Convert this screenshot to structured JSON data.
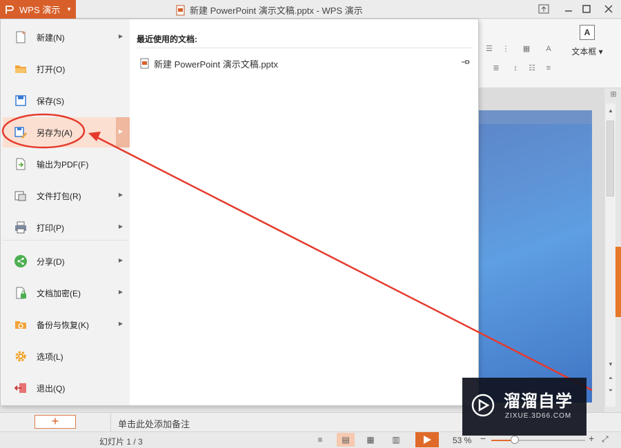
{
  "window": {
    "app_name": "WPS 演示",
    "title": "新建 PowerPoint 演示文稿.pptx - WPS 演示"
  },
  "colors": {
    "accent": "#d85f2a",
    "hover": "#fbdfd1",
    "annotation": "#e53a2d"
  },
  "file_menu": {
    "items": [
      {
        "label": "新建(N)",
        "icon": "new-document-icon",
        "submenu": true
      },
      {
        "label": "打开(O)",
        "icon": "open-folder-icon",
        "submenu": false
      },
      {
        "label": "保存(S)",
        "icon": "save-icon",
        "submenu": false
      },
      {
        "label": "另存为(A)",
        "icon": "save-as-icon",
        "submenu": true,
        "highlighted": true
      },
      {
        "label": "输出为PDF(F)",
        "icon": "pdf-export-icon",
        "submenu": false
      },
      {
        "label": "文件打包(R)",
        "icon": "package-icon",
        "submenu": true
      },
      {
        "label": "打印(P)",
        "icon": "printer-icon",
        "submenu": true
      },
      {
        "label": "分享(D)",
        "icon": "share-icon",
        "submenu": true
      },
      {
        "label": "文档加密(E)",
        "icon": "encrypt-icon",
        "submenu": true
      },
      {
        "label": "备份与恢复(K)",
        "icon": "backup-icon",
        "submenu": true
      },
      {
        "label": "选项(L)",
        "icon": "gear-icon",
        "submenu": false
      },
      {
        "label": "退出(Q)",
        "icon": "exit-icon",
        "submenu": false
      }
    ],
    "recent": {
      "title": "最近使用的文档:",
      "files": [
        "新建 PowerPoint 演示文稿.pptx"
      ]
    }
  },
  "ribbon": {
    "textbox_label": "文本框",
    "textbox_icon_letter": "A"
  },
  "notes": {
    "placeholder": "单击此处添加备注",
    "add_label": "+"
  },
  "status": {
    "slide_count": "幻灯片 1 / 3",
    "zoom": "53 %",
    "zoom_value": 0.25
  },
  "watermark": {
    "title": "溜溜自学",
    "url": "ZIXUE.3D66.COM"
  }
}
